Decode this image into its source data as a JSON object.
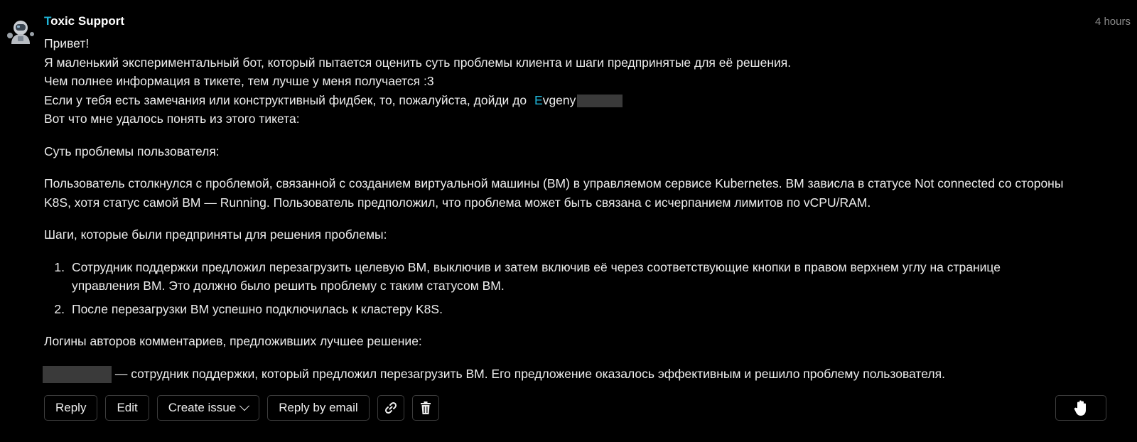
{
  "author": {
    "first_letter": "T",
    "rest": "oxic Support"
  },
  "timestamp": "4 hours",
  "message": {
    "greeting": "Привет!",
    "intro": "Я маленький экспериментальный бот, который пытается оценить суть проблемы клиента и шаги предпринятые для её решения.",
    "more_info": "Чем полнее информация в тикете, тем лучше у меня получается :3",
    "feedback_prefix": "Если у тебя есть замечания или конструктивный фидбек, то, пожалуйста, дойди до",
    "mention_first": "E",
    "mention_rest": "vgeny",
    "understood": "Вот что мне удалось понять из этого тикета:",
    "problem_heading": "Суть проблемы пользователя:",
    "problem_line1": "Пользователь столкнулся с проблемой, связанной с созданием виртуальной машины (ВМ) в управляемом сервисе Kubernetes. ВМ зависла в статусе Not connected со стороны",
    "problem_line2": "K8S, хотя статус самой ВМ — Running. Пользователь предположил, что проблема может быть связана с исчерпанием лимитов по vCPU/RAM.",
    "steps_heading": "Шаги, которые были предприняты для решения проблемы:",
    "steps": [
      {
        "num": "1.",
        "line1": "Сотрудник поддержки предложил перезагрузить целевую ВМ, выключив и затем включив её через соответствующие кнопки в правом верхнем углу на странице",
        "line2": "управления ВМ. Это должно было решить проблему с таким статусом ВМ."
      },
      {
        "num": "2.",
        "line1": "После перезагрузки ВМ успешно подключилась к кластеру K8S.",
        "line2": ""
      }
    ],
    "logins_heading": "Логины авторов комментариев, предложивших лучшее решение:",
    "author_comment": "— сотрудник поддержки, который предложил перезагрузить ВМ. Его предложение оказалось эффективным и решило проблему пользователя."
  },
  "toolbar": {
    "reply": "Reply",
    "edit": "Edit",
    "create_issue": "Create issue",
    "reply_by_email": "Reply by email"
  },
  "icons": {
    "avatar": "astronaut-avatar",
    "copy_link": "link-icon",
    "delete": "trash-icon",
    "hand": "hand-icon"
  },
  "colors": {
    "accent": "#1fb5d8",
    "background": "#000000",
    "text": "#ededed",
    "muted": "#8a8a8a"
  }
}
